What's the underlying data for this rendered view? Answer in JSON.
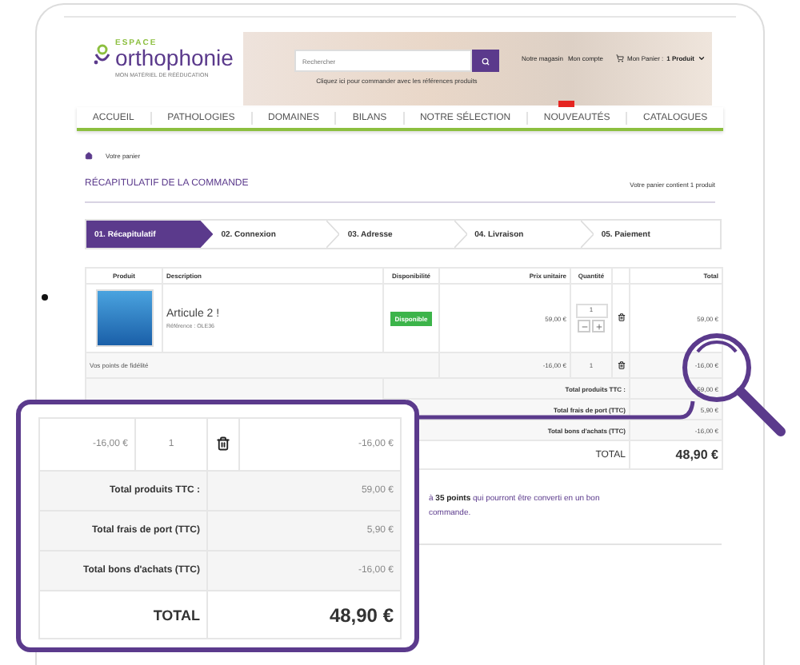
{
  "header": {
    "logo": {
      "small": "ESPACE",
      "name": "orthophonie",
      "tagline": "MON MATÉRIEL DE RÉÉDUCATION"
    },
    "search": {
      "placeholder": "Rechercher"
    },
    "search_hint": "Cliquez ici pour commander avec les références produits",
    "links": [
      "Notre magasin",
      "Mon compte"
    ],
    "cart": {
      "label": "Mon Panier :",
      "count": "1 Produit"
    }
  },
  "nav": [
    {
      "label": "ACCUEIL",
      "badge": false
    },
    {
      "label": "PATHOLOGIES",
      "badge": false
    },
    {
      "label": "DOMAINES",
      "badge": false
    },
    {
      "label": "BILANS",
      "badge": false
    },
    {
      "label": "NOTRE SÉLECTION",
      "badge": false
    },
    {
      "label": "NOUVEAUTÉS",
      "badge": true
    },
    {
      "label": "CATALOGUES",
      "badge": false
    }
  ],
  "breadcrumb": [
    "Votre panier"
  ],
  "title": "RÉCAPITULATIF DE LA COMMANDE",
  "cart_summary": "Votre panier contient 1 produit",
  "steps": [
    {
      "label": "01. Récapitulatif",
      "selected": true
    },
    {
      "label": "02. Connexion",
      "selected": false
    },
    {
      "label": "03. Adresse",
      "selected": false
    },
    {
      "label": "04. Livraison",
      "selected": false
    },
    {
      "label": "05. Paiement",
      "selected": false
    }
  ],
  "table": {
    "columns": [
      "Produit",
      "Description",
      "Disponibilité",
      "Prix unitaire",
      "Quantité",
      "Total"
    ],
    "rows": [
      {
        "kind": "product",
        "name": "Articule 2 !",
        "reference": "Référence : OLE36",
        "availability": "Disponible",
        "unit_price": "59,00 €",
        "quantity": "1",
        "total": "59,00 €"
      },
      {
        "kind": "voucher",
        "name": "Vos points de fidélité",
        "unit_price": "-16,00 €",
        "quantity": "1",
        "total": "-16,00 €"
      }
    ],
    "totals": [
      {
        "label": "Total produits TTC :",
        "value": "59,00 €",
        "grand": false
      },
      {
        "label": "Total frais de port (TTC)",
        "value": "5,90 €",
        "grand": false
      },
      {
        "label": "Total bons d'achats (TTC)",
        "value": "-16,00 €",
        "grand": false
      },
      {
        "label": "TOTAL",
        "value": "48,90 €",
        "grand": true
      }
    ]
  },
  "loyalty_message": [
    "à **35 points** qui pourront être converti en un bon",
    "commande."
  ],
  "callout": {
    "row": {
      "unit_price": "-16,00 €",
      "quantity": "1",
      "total": "-16,00 €"
    },
    "totals": [
      {
        "label": "Total produits TTC :",
        "value": "59,00 €",
        "grand": false
      },
      {
        "label": "Total frais de port (TTC)",
        "value": "5,90 €",
        "grand": false
      },
      {
        "label": "Total bons d'achats (TTC)",
        "value": "-16,00 €",
        "grand": false
      },
      {
        "label": "TOTAL",
        "value": "48,90 €",
        "grand": true
      }
    ]
  }
}
